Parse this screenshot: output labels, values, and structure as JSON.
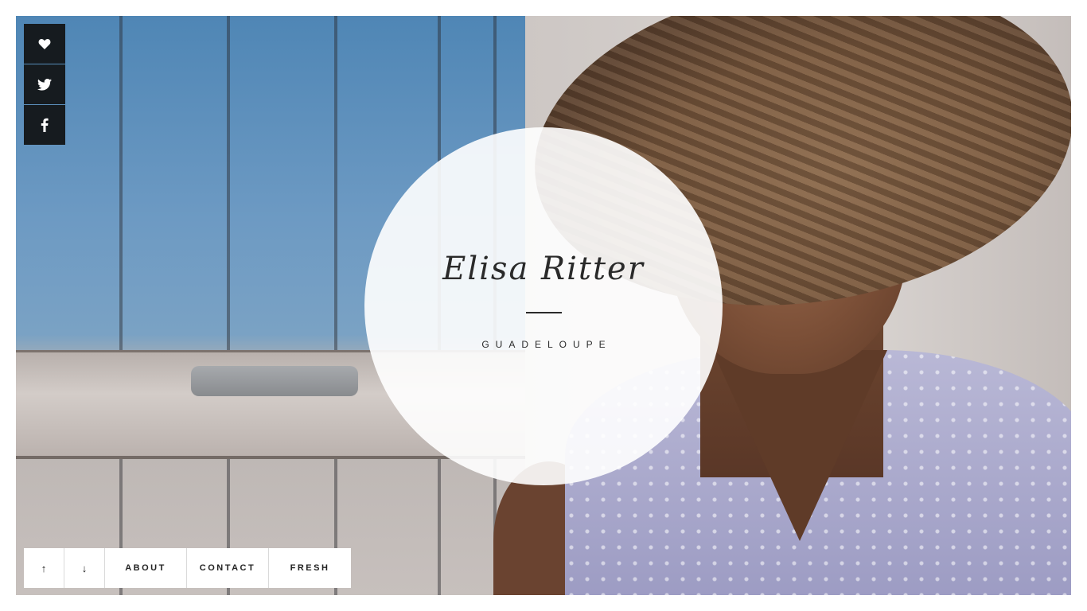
{
  "hero": {
    "name": "Elisa Ritter",
    "location": "GUADELOUPE"
  },
  "social": [
    {
      "icon": "heart-icon",
      "glyph": "♥"
    },
    {
      "icon": "twitter-icon",
      "glyph": "🐦"
    },
    {
      "icon": "facebook-icon",
      "glyph": "f"
    }
  ],
  "nav": {
    "up_glyph": "↑",
    "down_glyph": "↓",
    "about_label": "ABOUT",
    "contact_label": "CONTACT",
    "fresh_label": "FRESH"
  }
}
